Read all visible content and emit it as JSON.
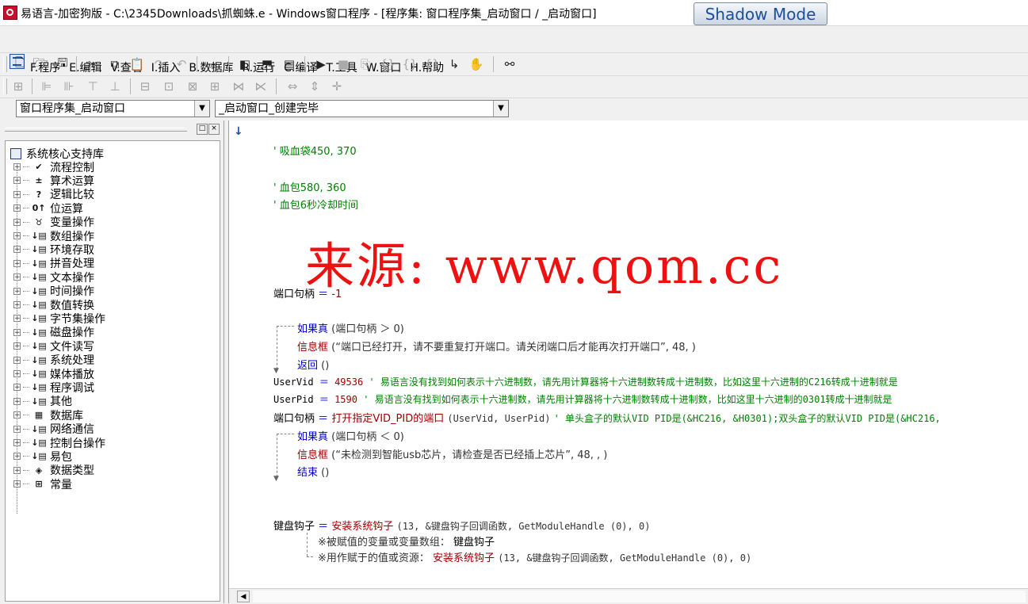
{
  "window": {
    "title": "易语言-加密狗版 - C:\\2345Downloads\\抓蜘蛛.e - Windows窗口程序 - [程序集: 窗口程序集_启动窗口 / _启动窗口]",
    "shadow_mode_label": "Shadow Mode"
  },
  "menu": {
    "items": [
      "F.程序",
      "E.编辑",
      "V.查看",
      "I.插入",
      "B.数据库",
      "R.运行",
      "C.编译",
      "T.工具",
      "W.窗口",
      "H.帮助"
    ]
  },
  "combos": {
    "class_combo": "窗口程序集_启动窗口",
    "method_combo": "_启动窗口_创建完毕"
  },
  "tree": {
    "root": "系统核心支持库",
    "items": [
      {
        "icon": "check-icon",
        "label": "流程控制"
      },
      {
        "icon": "math-icon",
        "label": "算术运算"
      },
      {
        "icon": "question-icon",
        "label": "逻辑比较"
      },
      {
        "icon": "bit-icon",
        "label": "位运算"
      },
      {
        "icon": "variable-icon",
        "label": "变量操作"
      },
      {
        "icon": "command-icon",
        "label": "数组操作"
      },
      {
        "icon": "command-icon",
        "label": "环境存取"
      },
      {
        "icon": "command-icon",
        "label": "拼音处理"
      },
      {
        "icon": "command-icon",
        "label": "文本操作"
      },
      {
        "icon": "command-icon",
        "label": "时间操作"
      },
      {
        "icon": "command-icon",
        "label": "数值转换"
      },
      {
        "icon": "command-icon",
        "label": "字节集操作"
      },
      {
        "icon": "command-icon",
        "label": "磁盘操作"
      },
      {
        "icon": "command-icon",
        "label": "文件读写"
      },
      {
        "icon": "command-icon",
        "label": "系统处理"
      },
      {
        "icon": "command-icon",
        "label": "媒体播放"
      },
      {
        "icon": "command-icon",
        "label": "程序调试"
      },
      {
        "icon": "command-icon",
        "label": "其他"
      },
      {
        "icon": "table-icon",
        "label": "数据库"
      },
      {
        "icon": "command-icon",
        "label": "网络通信"
      },
      {
        "icon": "command-icon",
        "label": "控制台操作"
      },
      {
        "icon": "command-icon",
        "label": "易包"
      },
      {
        "icon": "datatype-icon",
        "label": "数据类型"
      },
      {
        "icon": "constant-icon",
        "label": "常量"
      }
    ]
  },
  "code": {
    "comment1": "' 吸血袋450, 370",
    "comment2": "' 血包580, 360",
    "comment3": "' 血包6秒冷却时间",
    "watermark": "来源: www.qom.cc",
    "l1_var": "端口句柄",
    "l1_op": "＝",
    "l1_val": "-1",
    "if1_kw": "如果真",
    "if1_cond": "(端口句柄 ＞ 0)",
    "msg1_cmd": "信息框",
    "msg1_args": "(“端口已经打开，请不要重复打开端口。请关闭端口后才能再次打开端口”, 48, )",
    "ret_kw": "返回",
    "ret_args": "()",
    "vid_var": "UserVid",
    "vid_op": "＝",
    "vid_val": "49536",
    "vid_comment": "' 易语言没有找到如何表示十六进制数，请先用计算器将十六进制数转成十进制数，比如这里十六进制的C216转成十进制就是",
    "pid_var": "UserPid",
    "pid_op": "＝",
    "pid_val": "1590",
    "pid_comment": "' 易语言没有找到如何表示十六进制数，请先用计算器将十六进制数转成十进制数，比如这里十六进制的0301转成十进制就是",
    "open_var": "端口句柄",
    "open_op": "＝",
    "open_cmd": "打开指定VID_PID的端口",
    "open_args": "(UserVid, UserPid)",
    "open_comment": "' 单头盒子的默认VID PID是(&HC216, &H0301);双头盒子的默认VID PID是(&HC216,",
    "if2_kw": "如果真",
    "if2_cond": "(端口句柄 ＜ 0)",
    "msg2_cmd": "信息框",
    "msg2_args": "(“未检测到智能usb芯片，请检查是否已经插上芯片”, 48, , )",
    "end_kw": "结束",
    "end_args": "()",
    "hook_var": "键盘钩子",
    "hook_op": "＝",
    "hook_cmd": "安装系统钩子",
    "hook_args": "(13, &键盘钩子回调函数, GetModuleHandle (0), 0)",
    "hook_sub1_label": "※被赋值的变量或变量数组：",
    "hook_sub1_val": "键盘钩子",
    "hook_sub2_label": "※用作赋于的值或资源：",
    "hook_sub2_cmd": "安装系统钩子",
    "hook_sub2_args": "(13, &键盘钩子回调函数, GetModuleHandle (0), 0)"
  }
}
